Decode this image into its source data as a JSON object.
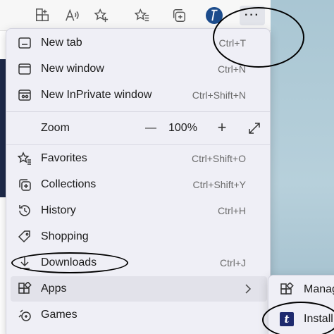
{
  "menu": {
    "items": [
      {
        "label": "New tab",
        "shortcut": "Ctrl+T",
        "icon": "new-tab-icon"
      },
      {
        "label": "New window",
        "shortcut": "Ctrl+N",
        "icon": "new-window-icon"
      },
      {
        "label": "New InPrivate window",
        "shortcut": "Ctrl+Shift+N",
        "icon": "inprivate-icon"
      },
      {
        "label": "Favorites",
        "shortcut": "Ctrl+Shift+O",
        "icon": "favorites-icon"
      },
      {
        "label": "Collections",
        "shortcut": "Ctrl+Shift+Y",
        "icon": "collections-icon"
      },
      {
        "label": "History",
        "shortcut": "Ctrl+H",
        "icon": "history-icon"
      },
      {
        "label": "Shopping",
        "shortcut": "",
        "icon": "shopping-tag-icon"
      },
      {
        "label": "Downloads",
        "shortcut": "Ctrl+J",
        "icon": "download-icon"
      },
      {
        "label": "Apps",
        "shortcut": "",
        "icon": "apps-icon"
      },
      {
        "label": "Games",
        "shortcut": "",
        "icon": "games-icon"
      }
    ],
    "zoom": {
      "label": "Zoom",
      "value": "100%",
      "minus": "—",
      "plus": "+"
    }
  },
  "submenu": {
    "items": [
      {
        "label": "Manag",
        "icon": "apps-icon"
      },
      {
        "label": "Install",
        "icon": "site-app-icon",
        "badge": "t"
      }
    ]
  },
  "toolbar": {
    "more_label": "···",
    "avatar_glyph": "t"
  },
  "colors": {
    "menu_bg": "#efeff6",
    "hover_bg": "#e2e2ea",
    "accent_dark": "#1e2a6e"
  }
}
